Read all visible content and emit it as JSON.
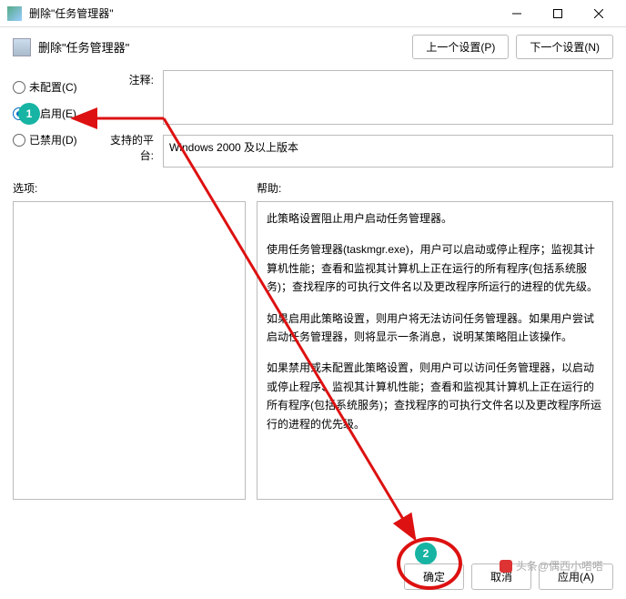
{
  "titlebar": {
    "title": "删除\"任务管理器\""
  },
  "header": {
    "title": "删除\"任务管理器\"",
    "prev": "上一个设置(P)",
    "next": "下一个设置(N)"
  },
  "radios": {
    "not_configured": "未配置(C)",
    "enabled": "已启用(E)",
    "disabled": "已禁用(D)"
  },
  "labels": {
    "comment": "注释:",
    "platform": "支持的平台:",
    "options": "选项:",
    "help": "帮助:"
  },
  "platform_text": "Windows 2000 及以上版本",
  "help_text": {
    "p1": "此策略设置阻止用户启动任务管理器。",
    "p2": "使用任务管理器(taskmgr.exe)，用户可以启动或停止程序；监视其计算机性能；查看和监视其计算机上正在运行的所有程序(包括系统服务)；查找程序的可执行文件名以及更改程序所运行的进程的优先级。",
    "p3": "如果启用此策略设置，则用户将无法访问任务管理器。如果用户尝试启动任务管理器，则将显示一条消息，说明某策略阻止该操作。",
    "p4": "如果禁用或未配置此策略设置，则用户可以访问任务管理器，以启动或停止程序、监视其计算机性能；查看和监视其计算机上正在运行的所有程序(包括系统服务)；查找程序的可执行文件名以及更改程序所运行的进程的优先级。"
  },
  "footer": {
    "ok": "确定",
    "cancel": "取消",
    "apply": "应用(A)"
  },
  "annotations": {
    "b1": "1",
    "b2": "2"
  },
  "watermark": "头条@偶西小嗒嗒"
}
